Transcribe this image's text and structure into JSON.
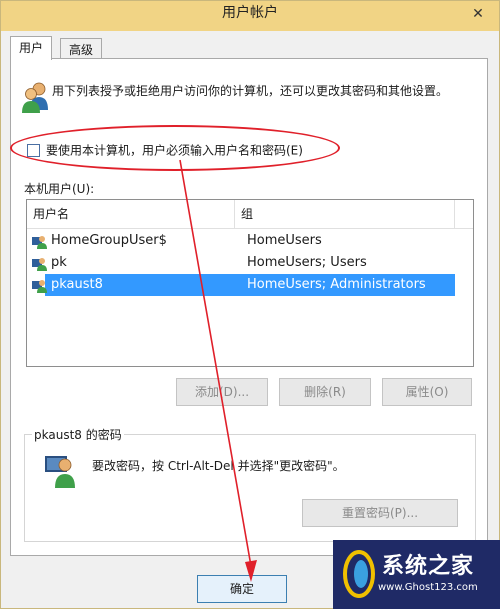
{
  "window": {
    "title": "用户帐户",
    "close_glyph": "✕"
  },
  "tabs": [
    {
      "label": "用户"
    },
    {
      "label": "高级"
    }
  ],
  "intro_text": "用下列表授予或拒绝用户访问你的计算机，还可以更改其密码和其他设置。",
  "require_password": {
    "label": "要使用本计算机，用户必须输入用户名和密码(E)",
    "checked": false
  },
  "users_list": {
    "label": "本机用户(U):",
    "columns": [
      "用户名",
      "组"
    ],
    "rows": [
      {
        "name": "HomeGroupUser$",
        "group": "HomeUsers"
      },
      {
        "name": "pk",
        "group": "HomeUsers; Users"
      },
      {
        "name": "pkaust8",
        "group": "HomeUsers; Administrators",
        "selected": true
      }
    ]
  },
  "list_buttons": {
    "add": "添加(D)...",
    "remove": "删除(R)",
    "properties": "属性(O)"
  },
  "password_group": {
    "title": "pkaust8 的密码",
    "text": "要改密码，按 Ctrl-Alt-Del 并选择\"更改密码\"。",
    "reset_button": "重置密码(P)..."
  },
  "footer": {
    "ok_button": "确定"
  },
  "watermark": {
    "title": "系统之家",
    "url": "www.Ghost123.com"
  },
  "colors": {
    "titlebar": "#f1d485",
    "selection": "#3399ff",
    "annotation": "#e0202a"
  },
  "icons": {
    "users": "users-icon",
    "user": "user-icon",
    "close": "close-icon"
  }
}
